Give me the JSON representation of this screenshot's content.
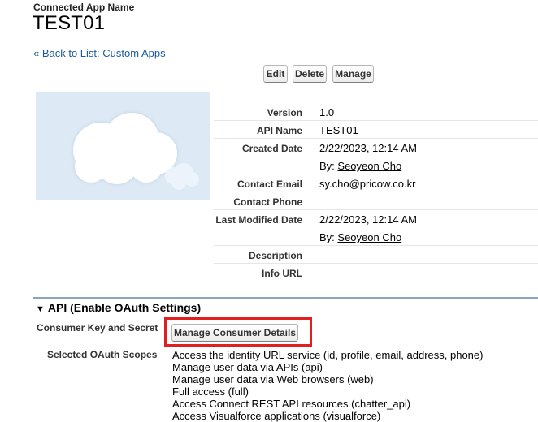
{
  "header": {
    "label": "Connected App Name",
    "title": "TEST01",
    "back_link": "« Back to List: Custom Apps"
  },
  "toolbar": {
    "edit_label": "Edit",
    "delete_label": "Delete",
    "manage_label": "Manage"
  },
  "details": {
    "version_label": "Version",
    "version_value": "1.0",
    "api_name_label": "API Name",
    "api_name_value": "TEST01",
    "created_date_label": "Created Date",
    "created_date_value": "2/22/2023, 12:14 AM",
    "created_by_prefix": "By: ",
    "created_by_user": "Seoyeon Cho",
    "contact_email_label": "Contact Email",
    "contact_email_value": "sy.cho@pricow.co.kr",
    "contact_phone_label": "Contact Phone",
    "contact_phone_value": "",
    "last_modified_label": "Last Modified Date",
    "last_modified_value": "2/22/2023, 12:14 AM",
    "modified_by_prefix": "By: ",
    "modified_by_user": "Seoyeon Cho",
    "description_label": "Description",
    "description_value": "",
    "info_url_label": "Info URL",
    "info_url_value": ""
  },
  "api_section": {
    "title": "API (Enable OAuth Settings)",
    "toggle_icon": "triangle-down-icon",
    "consumer_key_label": "Consumer Key and Secret",
    "manage_consumer_button": "Manage Consumer Details",
    "scopes_label": "Selected OAuth Scopes",
    "scopes": [
      "Access the identity URL service (id, profile, email, address, phone)",
      "Manage user data via APIs (api)",
      "Manage user data via Web browsers (web)",
      "Full access (full)",
      "Access Connect REST API resources (chatter_api)",
      "Access Visualforce applications (visualforce)"
    ]
  },
  "colors": {
    "link": "#1a5b9c",
    "highlight": "#e02020",
    "section_rule": "#8aa3c0",
    "logo_bg": "#dde9f4"
  }
}
